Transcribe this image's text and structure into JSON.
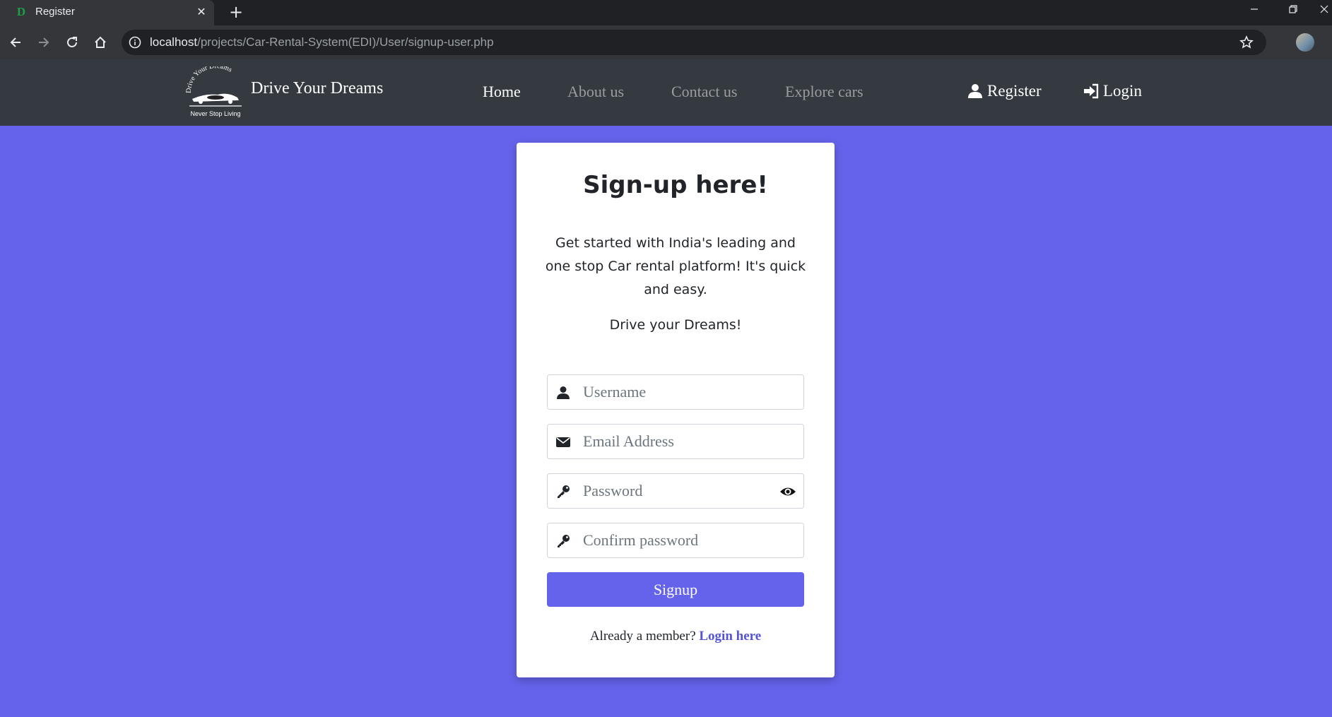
{
  "browser": {
    "tab_title": "Register",
    "tab_favicon_letter": "D",
    "tab_close": "✕",
    "new_tab": "+",
    "url_host": "localhost",
    "url_path": "/projects/Car-Rental-System(EDI)/User/signup-user.php"
  },
  "navbar": {
    "brand_name": "Drive Your Dreams",
    "logo_text_top": "Drive Your Dreams",
    "logo_text_bottom": "Never Stop Living",
    "links": [
      "Home",
      "About us",
      "Contact us",
      "Explore cars"
    ],
    "register": "Register",
    "login": "Login",
    "background": "#343a40"
  },
  "card": {
    "title": "Sign-up here!",
    "description": "Get started with India's leading and one stop Car rental platform! It's quick and easy.",
    "tagline": "Drive your Dreams!",
    "fields": {
      "username_placeholder": "Username",
      "email_placeholder": "Email Address",
      "password_placeholder": "Password",
      "confirm_placeholder": "Confirm password"
    },
    "signup_button": "Signup",
    "member_text": "Already a member?",
    "login_link": "Login here"
  },
  "colors": {
    "page_background": "#6563eb",
    "accent": "#6563eb",
    "link": "#5553d6"
  },
  "icons": {
    "username": "user-icon",
    "email": "envelope-icon",
    "password": "key-icon",
    "confirm": "key-icon",
    "toggle": "eye-icon"
  }
}
